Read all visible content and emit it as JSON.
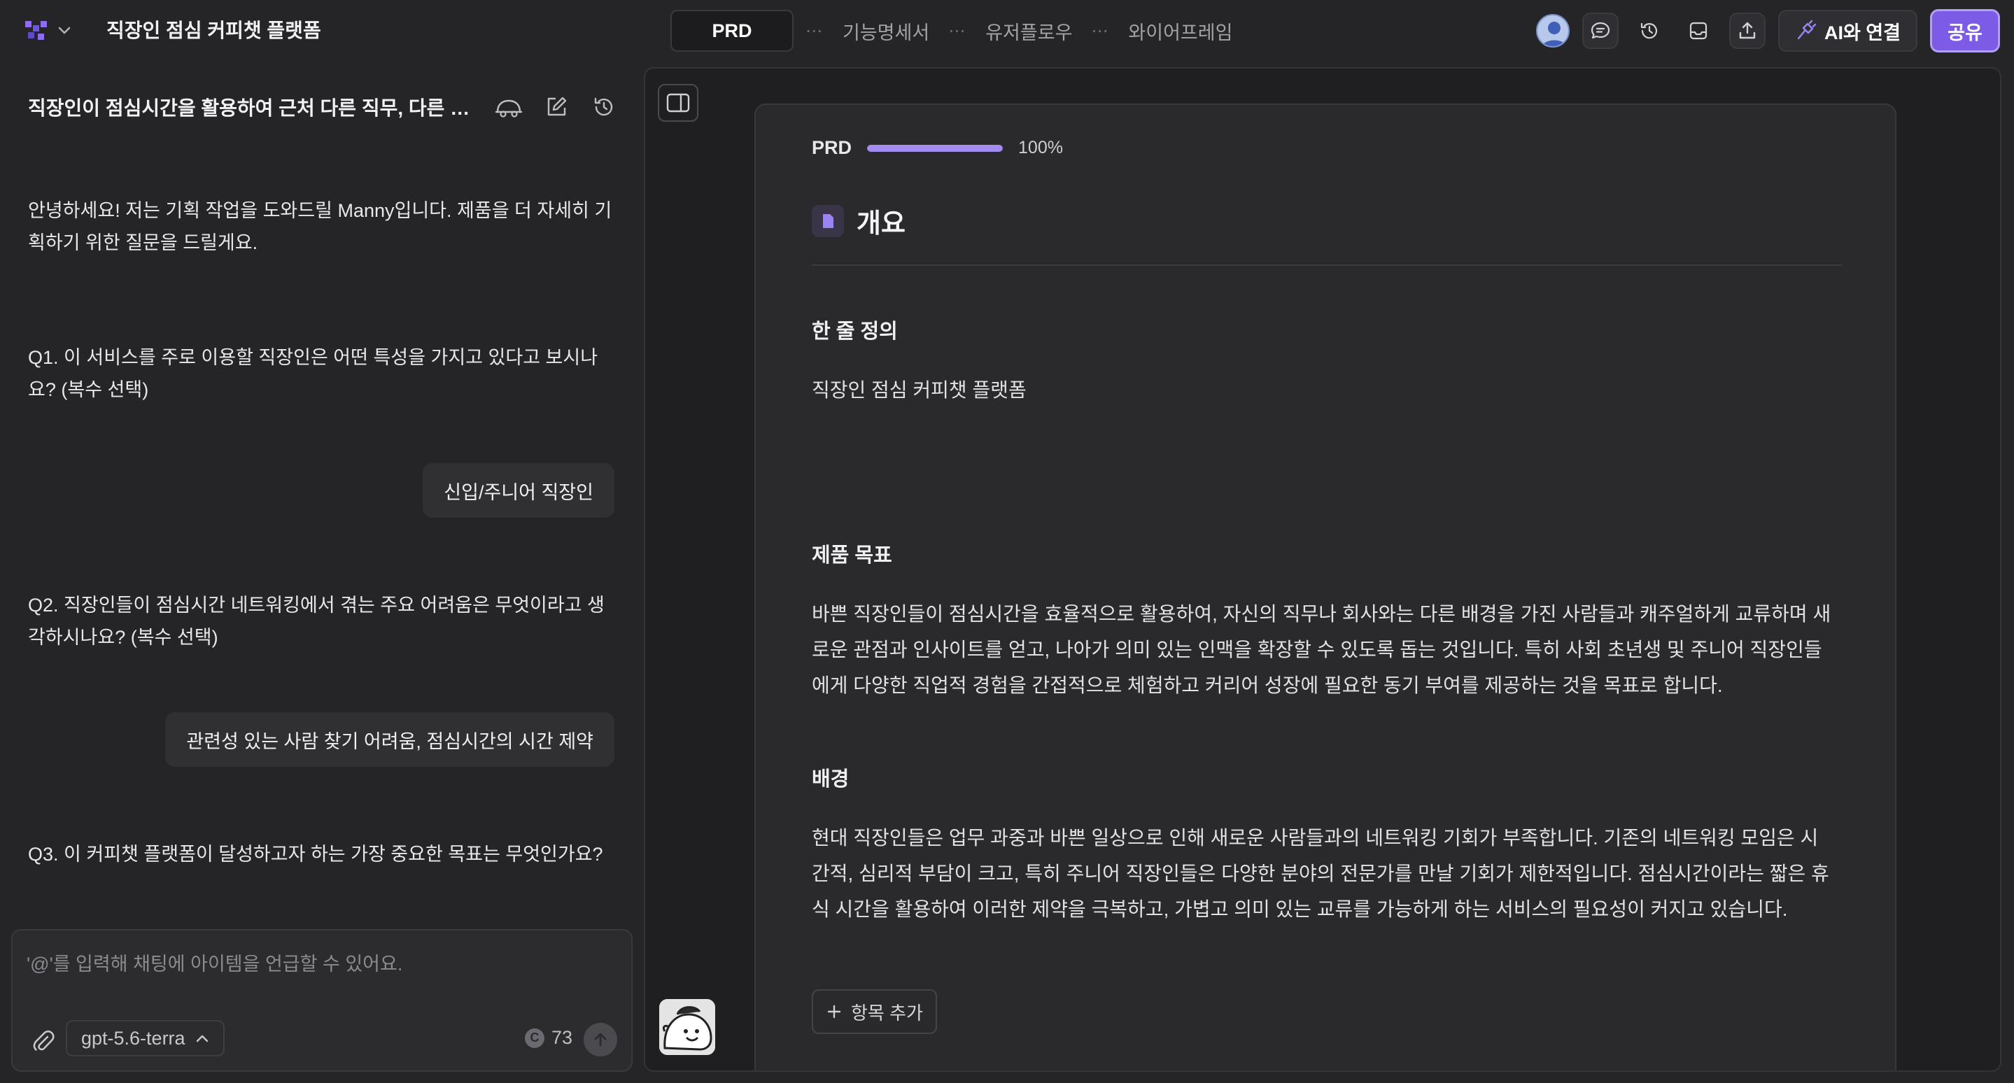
{
  "header": {
    "project_title": "직장인 점심 커피챗 플랫폼",
    "tabs": [
      {
        "label": "PRD"
      },
      {
        "label": "기능명세서"
      },
      {
        "label": "유저플로우"
      },
      {
        "label": "와이어프레임"
      }
    ],
    "tab_separator": "⋯",
    "ai_connect_label": "AI와 연결",
    "share_label": "공유"
  },
  "chat": {
    "title": "직장인이 점심시간을 활용하여 근처 다른 직무, 다른 회사 사람들과 커피챗을 할 수 있는 플랫폼",
    "messages": [
      {
        "role": "assistant",
        "text": "안녕하세요! 저는 기획 작업을 도와드릴 Manny입니다. 제품을 더 자세히 기획하기 위한 질문을 드릴게요."
      },
      {
        "role": "assistant",
        "text": "Q1. 이 서비스를 주로 이용할 직장인은 어떤 특성을 가지고 있다고 보시나요? (복수 선택)"
      },
      {
        "role": "user",
        "text": "신입/주니어 직장인"
      },
      {
        "role": "assistant",
        "text": "Q2. 직장인들이 점심시간 네트워킹에서 겪는 주요 어려움은 무엇이라고 생각하시나요? (복수 선택)"
      },
      {
        "role": "user",
        "text": "관련성 있는 사람 찾기 어려움, 점심시간의 시간 제약"
      },
      {
        "role": "assistant",
        "text": "Q3. 이 커피챗 플랫폼이 달성하고자 하는 가장 중요한 목표는 무엇인가요?"
      }
    ],
    "composer": {
      "placeholder": "'@'를 입력해 채팅에 아이템을 언급할 수 있어요.",
      "value": "",
      "model": "gpt-5.6-terra",
      "credits": "73",
      "credit_symbol": "C"
    }
  },
  "document": {
    "progress_label": "PRD",
    "progress_percent": 100,
    "progress_text": "100%",
    "section_title": "개요",
    "subsections": [
      {
        "heading": "한 줄 정의",
        "body": "직장인 점심 커피챗 플랫폼"
      },
      {
        "heading": "제품 목표",
        "body": "바쁜 직장인들이 점심시간을 효율적으로 활용하여, 자신의 직무나 회사와는 다른 배경을 가진 사람들과 캐주얼하게 교류하며 새로운 관점과 인사이트를 얻고, 나아가 의미 있는 인맥을 확장할 수 있도록 돕는 것입니다. 특히 사회 초년생 및 주니어 직장인들에게 다양한 직업적 경험을 간접적으로 체험하고 커리어 성장에 필요한 동기 부여를 제공하는 것을 목표로 합니다."
      },
      {
        "heading": "배경",
        "body": "현대 직장인들은 업무 과중과 바쁜 일상으로 인해 새로운 사람들과의 네트워킹 기회가 부족합니다. 기존의 네트워킹 모임은 시간적, 심리적 부담이 크고, 특히 주니어 직장인들은 다양한 분야의 전문가를 만날 기회가 제한적입니다. 점심시간이라는 짧은 휴식 시간을 활용하여 이러한 제약을 극복하고, 가볍고 의미 있는 교류를 가능하게 하는 서비스의 필요성이 커지고 있습니다."
      }
    ],
    "add_item_label": "항목 추가"
  },
  "colors": {
    "accent": "#7c5ce6",
    "progress": "#a38bf2",
    "background": "#252527"
  }
}
